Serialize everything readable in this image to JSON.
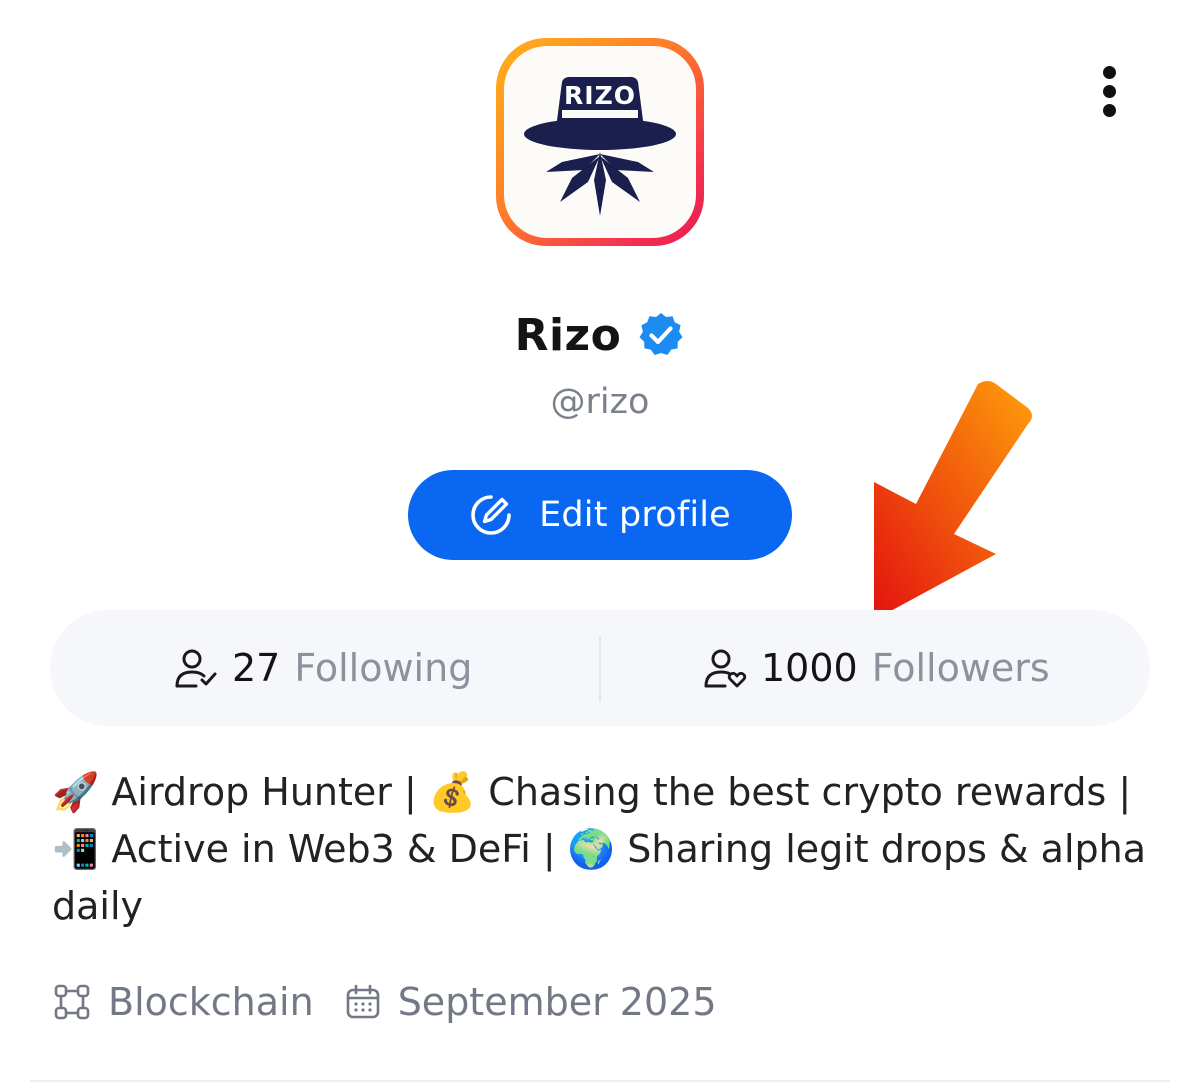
{
  "profile": {
    "name": "Rizo",
    "handle": "@rizo",
    "avatar_text": "RIZO",
    "verified_icon": "verified-badge-icon"
  },
  "actions": {
    "edit_label": "Edit profile",
    "edit_icon": "pencil-circle-icon",
    "menu_icon": "more-vertical-icon"
  },
  "stats": {
    "following_count": "27",
    "following_label": "Following",
    "followers_count": "1000",
    "followers_label": "Followers"
  },
  "bio": {
    "segments": [
      {
        "emoji": "🚀",
        "text": " Airdrop Hunter | "
      },
      {
        "emoji": "💰",
        "text": " Chasing the best crypto rewards | "
      },
      {
        "emoji": "📲",
        "text": " Active in Web3 & DeFi | "
      },
      {
        "emoji": "🌍",
        "text": " Sharing legit drops & alpha daily"
      }
    ]
  },
  "meta": {
    "category": "Blockchain",
    "category_icon": "nodes-icon",
    "joined": "September 2025",
    "joined_icon": "calendar-icon"
  },
  "colors": {
    "primary": "#0a67f2",
    "verified": "#1d8cf0",
    "arrow_start": "#ff9f0a",
    "arrow_end": "#e3110f"
  }
}
